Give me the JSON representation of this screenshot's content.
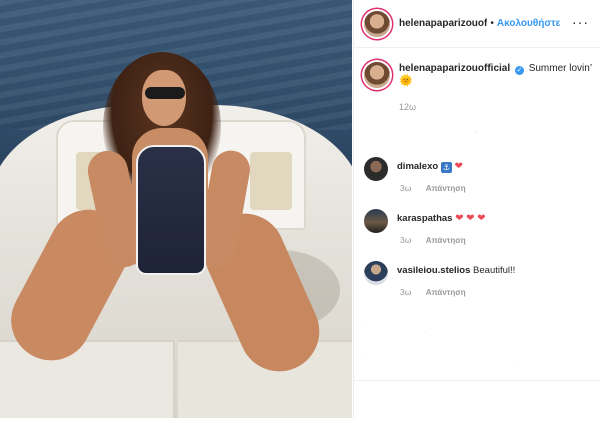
{
  "post": {
    "photo_alt": "",
    "header": {
      "username": "helenapaparizouof",
      "separator": "•",
      "follow_label": "Ακολουθήστε",
      "more_label": "···"
    },
    "caption": {
      "username": "helenapaparizouofficial",
      "verified_mark": "✓",
      "text": "Summer lovin’",
      "emoji": "🌞",
      "time": "12ω"
    },
    "comments": [
      {
        "username": "dimalexo",
        "text": "",
        "icons": [
          "⚓",
          "❤"
        ],
        "time": "3ω",
        "reply_label": "Απάντηση"
      },
      {
        "username": "karaspathas",
        "text": "",
        "icons": [
          "❤",
          "❤",
          "❤"
        ],
        "time": "3ω",
        "reply_label": "Απάντηση"
      },
      {
        "username": "vasileiou.stelios",
        "text": "Beautiful!!",
        "icons": [],
        "time": "3ω",
        "reply_label": "Απάντηση"
      }
    ]
  },
  "colors": {
    "follow_blue": "#3897f0",
    "heart_red": "#ed4956",
    "muted_gray": "#999999"
  }
}
